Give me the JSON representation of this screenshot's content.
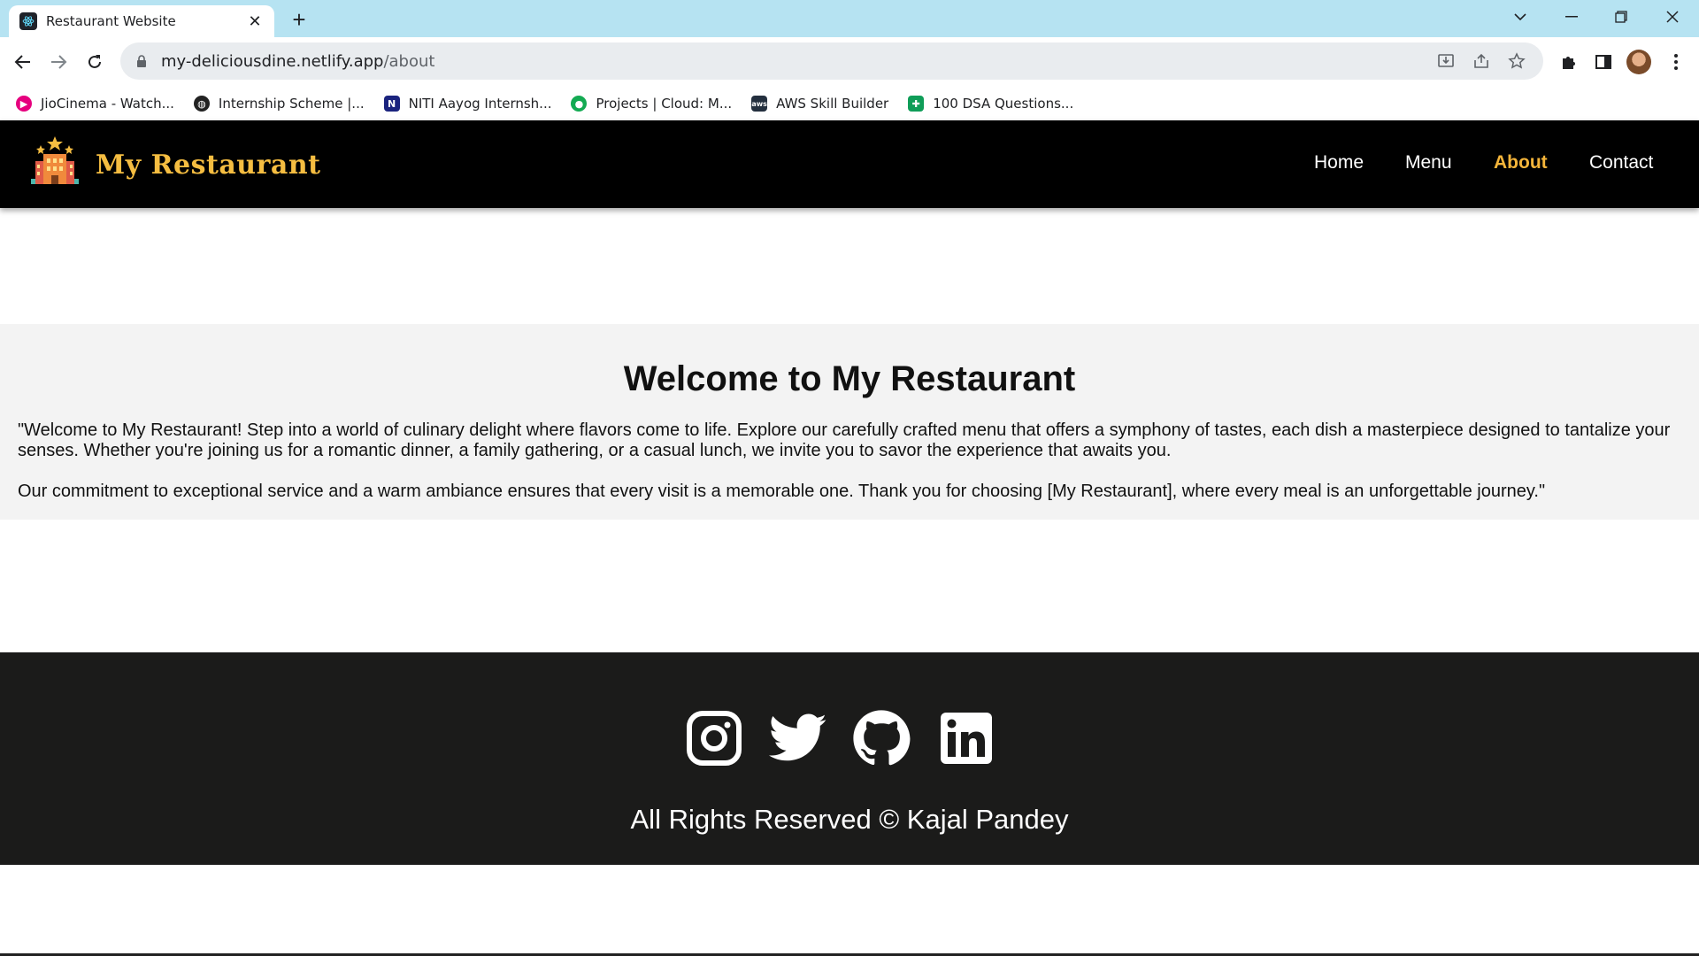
{
  "browser": {
    "tab_title": "Restaurant Website",
    "tab_close": "✕",
    "new_tab": "+",
    "url_host": "my-deliciousdine.netlify.app",
    "url_path": "/about",
    "bookmarks": [
      {
        "label": "JioCinema - Watch...",
        "color": "#e6007e",
        "icon": "jiocinema-icon"
      },
      {
        "label": "Internship Scheme |...",
        "color": "#222222",
        "icon": "globe-icon"
      },
      {
        "label": "NITI Aayog Internsh...",
        "color": "#1a237e",
        "icon": "niti-icon"
      },
      {
        "label": "Projects | Cloud: M...",
        "color": "#13aa52",
        "icon": "mongodb-icon"
      },
      {
        "label": "AWS Skill Builder",
        "color": "#232f3e",
        "icon": "aws-icon"
      },
      {
        "label": "100 DSA Questions...",
        "color": "#0f9d58",
        "icon": "sheets-icon"
      }
    ]
  },
  "site": {
    "brand": "My Restaurant",
    "nav": {
      "home": "Home",
      "menu": "Menu",
      "about": "About",
      "contact": "Contact"
    },
    "about": {
      "title": "Welcome to My Restaurant",
      "paragraph1": "\"Welcome to My Restaurant! Step into a world of culinary delight where flavors come to life. Explore our carefully crafted menu that offers a symphony of tastes, each dish a masterpiece designed to tantalize your senses. Whether you're joining us for a romantic dinner, a family gathering, or a casual lunch, we invite you to savor the experience that awaits you.",
      "paragraph2": "Our commitment to exceptional service and a warm ambiance ensures that every visit is a memorable one. Thank you for choosing [My Restaurant], where every meal is an unforgettable journey.\""
    },
    "footer": {
      "social": [
        "instagram-icon",
        "twitter-icon",
        "github-icon",
        "linkedin-icon"
      ],
      "copyright": "All Rights Reserved © Kajal Pandey"
    }
  },
  "colors": {
    "tabbar": "#b6e3f2",
    "nav_bg": "#000000",
    "brand": "#f5bd41",
    "active_nav": "#f5b53a",
    "section_bg": "#f3f3f3",
    "footer_bg": "#1b1b1a"
  }
}
